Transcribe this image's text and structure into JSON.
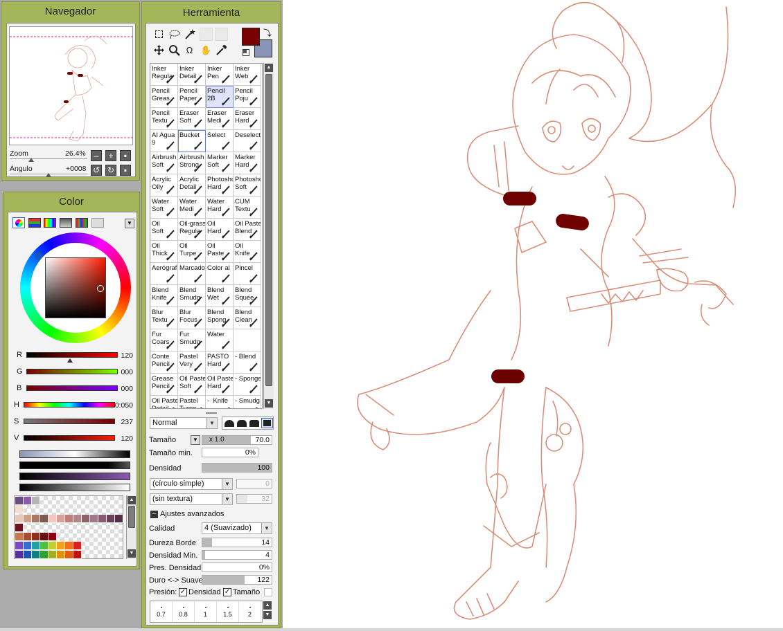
{
  "navigator": {
    "title": "Navegador",
    "zoom_label": "Zoom",
    "zoom_value": "26.4%",
    "angle_label": "Ángulo",
    "angle_value": "+0008"
  },
  "color": {
    "title": "Color",
    "rgb": [
      {
        "label": "R",
        "value": "120"
      },
      {
        "label": "G",
        "value": "000"
      },
      {
        "label": "B",
        "value": "000"
      }
    ],
    "hsv": [
      {
        "label": "H",
        "value": "0:050"
      },
      {
        "label": "S",
        "value": "237"
      },
      {
        "label": "V",
        "value": "120"
      }
    ],
    "primary_color": "#780000",
    "secondary_color": "#8a94b8"
  },
  "tool": {
    "title": "Herramienta",
    "tools_row1": [
      "rect-select-icon",
      "lasso-icon",
      "magic-wand-icon",
      "blank",
      "blank"
    ],
    "tools_row2": [
      "move-icon",
      "zoom-icon",
      "rotate-icon",
      "hand-icon",
      "eyedropper-icon"
    ],
    "brushes": [
      [
        "Inker\nRegula",
        "Inker\nDetail",
        "Inker\nPen",
        "Inker\nWeb"
      ],
      [
        "Pencil\nGreas",
        "Pencil\nPaper",
        "Pencil\n2B",
        "Pencil\nPoju"
      ],
      [
        "Pencil\nTextu",
        "Eraser\nSoft",
        "Eraser\nMedi",
        "Eraser\nHard"
      ],
      [
        "AI Agua\n9",
        "Bucket",
        "Select",
        "Deselect"
      ],
      [
        "Airbrush\nSoft",
        "Airbrush\nStrong",
        "Marker\nSoft",
        "Marker\nHard"
      ],
      [
        "Acrylic\nOily",
        "Acrylic\nDetail",
        "Photosho\nHard",
        "Photosho\nSoft"
      ],
      [
        "Water\nSoft",
        "Water\nMedi",
        "Water\nHard",
        "CUM\nTextu"
      ],
      [
        "Oil\nSoft",
        "Oil-grass\nRegula",
        "Oil\nHard",
        "Oil Paste\nBlend"
      ],
      [
        "Oil\nThick",
        "Oil\nTurpe",
        "Oil\nPaste",
        "Oil\nKnife"
      ],
      [
        "Aerógraf",
        "Marcado",
        "Color al",
        "Pincel"
      ],
      [
        "Blend\nKnife",
        "Blend\nSmudg",
        "Blend\nWet",
        "Blend\nSquee"
      ],
      [
        "Blur\nTextu",
        "Blur\nFocus",
        "Blend\nSpong",
        "Blend\nClean"
      ],
      [
        "Fur\nCoars",
        "Fur\nSmudg",
        "Water",
        ""
      ],
      [
        "Conte\nPencil",
        "Pastel\nVery",
        "PASTO\nHard",
        "- Blend"
      ],
      [
        "Grease\nPencil",
        "Oil Paste\nSoft",
        "Oil Paste\nHard",
        "- Sponge"
      ],
      [
        "Oil Paste\nDetail",
        "Pastel\nTurpe",
        "-  Knife",
        "- Smudg"
      ]
    ],
    "blend_mode": "Normal",
    "size_label": "Tamaño",
    "size_multiplier": "x 1.0",
    "size_value": "70.0",
    "min_size_label": "Tamaño min.",
    "min_size_value": "0%",
    "density_label": "Densidad",
    "density_value": "100",
    "shape": "(círculo simple)",
    "shape_value": "0",
    "texture": "(sin textura)",
    "texture_value": "32",
    "advanced_label": "Ajustes avanzados",
    "quality_label": "Calidad",
    "quality_value": "4 (Suavizado)",
    "edge_label": "Dureza Borde",
    "edge_value": "14",
    "min_density_label": "Densidad Min.",
    "min_density_value": "4",
    "pressure_density_label": "Pres. Densidad M",
    "pressure_density_value": "0%",
    "hard_soft_label": "Duro <-> Suave",
    "hard_soft_value": "122",
    "pressure_label": "Presión:",
    "pressure_density_check": "Densidad",
    "pressure_size_check": "Tamaño",
    "size_presets": [
      "0.7",
      "0.8",
      "1",
      "1.5",
      "2"
    ]
  }
}
